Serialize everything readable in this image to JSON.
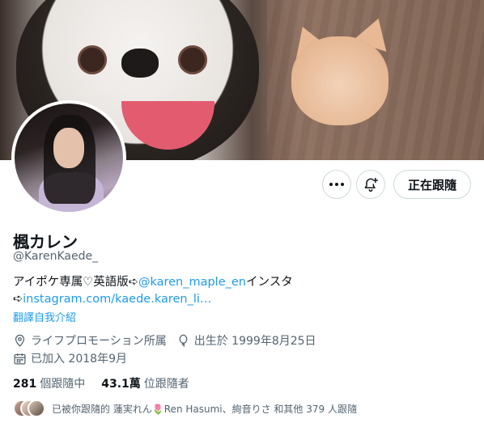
{
  "profile": {
    "display_name": "楓カレン",
    "handle": "@KarenKaede_",
    "bio_text_1": "アイポケ専属♡英語版➪",
    "bio_mention": "@karen_maple_en",
    "bio_text_2": "インスタ",
    "bio_arrow": "➪",
    "bio_link": "instagram.com/kaede.karen_li…",
    "translate_label": "翻譯自我介紹",
    "affiliation": "ライフプロモーション所属",
    "birthday": "出生於 1999年8月25日",
    "joined": "已加入 2018年9月"
  },
  "actions": {
    "follow_label": "正在跟隨"
  },
  "stats": {
    "following_count": "281",
    "following_label": "個跟隨中",
    "followers_count": "43.1萬",
    "followers_label": "位跟隨者"
  },
  "followed_by": {
    "text": "已被你跟隨的 蓮実れん🌷Ren Hasumi、絢音りさ 和其他 379 人跟隨"
  },
  "icons": {
    "more": "more-dots-icon",
    "notify": "bell-plus-icon",
    "location": "location-pin-icon",
    "birthday": "balloon-icon",
    "calendar": "calendar-icon"
  },
  "colors": {
    "link": "#1d9bf0",
    "muted": "#536471",
    "text": "#0f1419",
    "border": "#cfd9de"
  }
}
